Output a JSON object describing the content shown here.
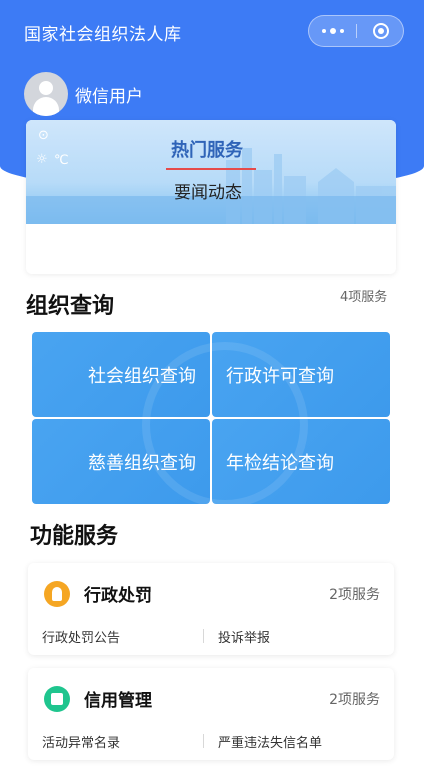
{
  "header": {
    "app_title": "国家社会组织法人库",
    "user_name": "微信用户"
  },
  "banner": {
    "weather_unit": "℃",
    "tabs": [
      "热门服务",
      "要闻动态"
    ],
    "active_tab": "热门服务"
  },
  "org_query": {
    "title": "组织查询",
    "count": "4项服务",
    "tiles": [
      "社会组织查询",
      "行政许可查询",
      "慈善组织查询",
      "年检结论查询"
    ]
  },
  "functions": {
    "title": "功能服务",
    "cards": [
      {
        "icon": "stamp-icon",
        "name": "行政处罚",
        "count": "2项服务",
        "links": [
          "行政处罚公告",
          "投诉举报"
        ]
      },
      {
        "icon": "wallet-icon",
        "name": "信用管理",
        "count": "2项服务",
        "links": [
          "活动异常名录",
          "严重违法失信名单"
        ]
      }
    ]
  },
  "colors": {
    "header_blue": "#3d7bf5",
    "tile_blue": "#49a4f1",
    "active_underline": "#e54b4b"
  }
}
